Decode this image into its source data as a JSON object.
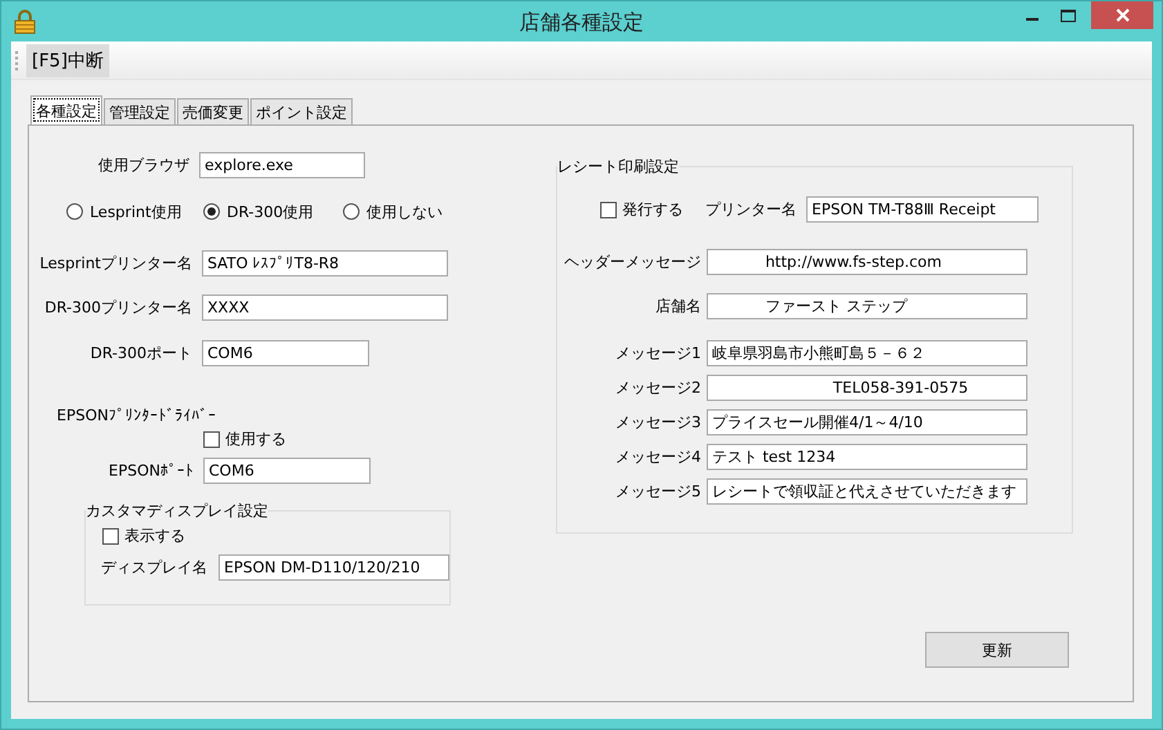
{
  "window": {
    "title": "店舗各種設定"
  },
  "toolbar": {
    "buttons": [
      {
        "label": "[F5]中断"
      }
    ]
  },
  "tabs": [
    {
      "label": "各種設定",
      "selected": true
    },
    {
      "label": "管理設定",
      "selected": false
    },
    {
      "label": "売価変更",
      "selected": false
    },
    {
      "label": "ポイント設定",
      "selected": false
    }
  ],
  "browser": {
    "label": "使用ブラウザ",
    "value": "explore.exe"
  },
  "printer_mode": [
    {
      "label": "Lesprint使用",
      "selected": false
    },
    {
      "label": "DR-300使用",
      "selected": true
    },
    {
      "label": "使用しない",
      "selected": false
    }
  ],
  "lesprint_printer": {
    "label": "Lesprintプリンター名",
    "value": "SATO ﾚｽﾌﾟﾘT8-R8"
  },
  "dr300_printer": {
    "label": "DR-300プリンター名",
    "value": "XXXX"
  },
  "dr300_port": {
    "label": "DR-300ポート",
    "value": "COM6"
  },
  "epson_driver": {
    "label": "EPSONﾌﾟﾘﾝﾀｰﾄﾞﾗｲﾊﾞｰ",
    "checkbox": {
      "label": "使用する",
      "checked": false
    }
  },
  "epson_port": {
    "label": "EPSONﾎﾟｰﾄ",
    "value": "COM6"
  },
  "customer_display": {
    "title": "カスタマディスプレイ設定",
    "checkbox": {
      "label": "表示する",
      "checked": false
    },
    "display_name": {
      "label": "ディスプレイ名",
      "value": "EPSON DM-D110/120/210"
    }
  },
  "receipt": {
    "title": "レシート印刷設定",
    "issue": {
      "label": "発行する",
      "checked": false
    },
    "printer": {
      "label": "プリンター名",
      "value": "EPSON TM-T88Ⅲ Receipt"
    },
    "header_fields": [
      {
        "label": "ヘッダーメッセージ",
        "value": "           http://www.fs-step.com"
      },
      {
        "label": "店舗名",
        "value": "           ファースト ステップ"
      }
    ],
    "messages": [
      {
        "label": "メッセージ1",
        "value": "岐阜県羽島市小熊町島５－６２"
      },
      {
        "label": "メッセージ2",
        "value": "                         TEL058-391-0575"
      },
      {
        "label": "メッセージ3",
        "value": "プライスセール開催4/1～4/10"
      },
      {
        "label": "メッセージ4",
        "value": "テスト test 1234"
      },
      {
        "label": "メッセージ5",
        "value": "レシートで領収証と代えさせていただきます"
      }
    ]
  },
  "update_button": {
    "label": "更新"
  }
}
